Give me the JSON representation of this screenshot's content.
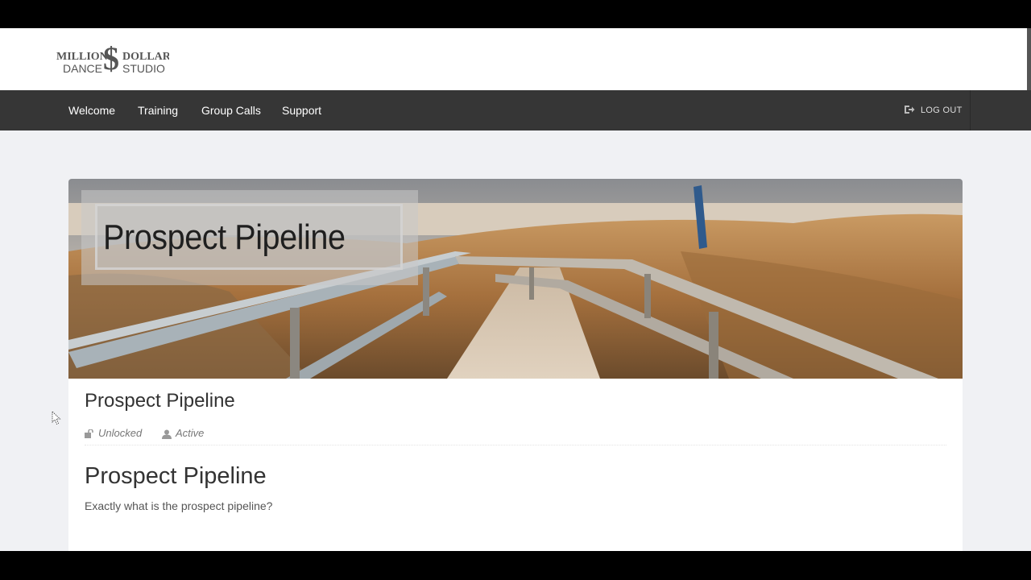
{
  "brand": {
    "logo_line1_left": "MILLION",
    "logo_symbol": "$",
    "logo_line1_right": "DOLLAR",
    "logo_line2_left": "DANCE",
    "logo_line2_right": "STUDIO"
  },
  "nav": {
    "items": [
      {
        "label": "Welcome"
      },
      {
        "label": "Training"
      },
      {
        "label": "Group Calls"
      },
      {
        "label": "Support"
      }
    ],
    "logout_label": "LOG OUT",
    "logout_icon": "sign-out-icon"
  },
  "banner": {
    "title": "Prospect Pipeline"
  },
  "lesson": {
    "title": "Prospect Pipeline",
    "lock_status": "Unlocked",
    "lock_icon": "unlock-icon",
    "activity_status": "Active",
    "activity_icon": "user-icon",
    "heading": "Prospect Pipeline",
    "body": "Exactly what is the prospect pipeline?"
  },
  "colors": {
    "navbar": "#363636",
    "page_background": "#f0f1f4",
    "banner_accent": "#3d78a8"
  }
}
